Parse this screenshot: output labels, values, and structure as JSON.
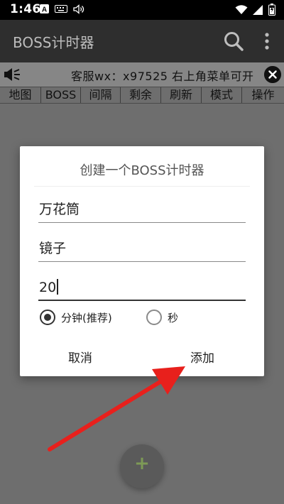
{
  "status_bar": {
    "time": "1:46"
  },
  "app_bar": {
    "title": "BOSS计时器"
  },
  "notice": {
    "text": "客服wx：x97525 右上角菜单可开"
  },
  "table_header": {
    "columns": [
      "地图",
      "BOSS",
      "间隔",
      "剩余",
      "刷新",
      "模式",
      "操作"
    ]
  },
  "dialog": {
    "title": "创建一个BOSS计时器",
    "map_value": "万花筒",
    "boss_value": "镜子",
    "interval_value": "20",
    "unit_options": [
      "分钟(推荐)",
      "秒"
    ],
    "unit_selected": "分钟(推荐)",
    "cancel_label": "取消",
    "add_label": "添加"
  },
  "fab": {
    "label": "+"
  },
  "colors": {
    "annotation_arrow": "#e8201c",
    "fab_plus": "#7d9a56"
  }
}
